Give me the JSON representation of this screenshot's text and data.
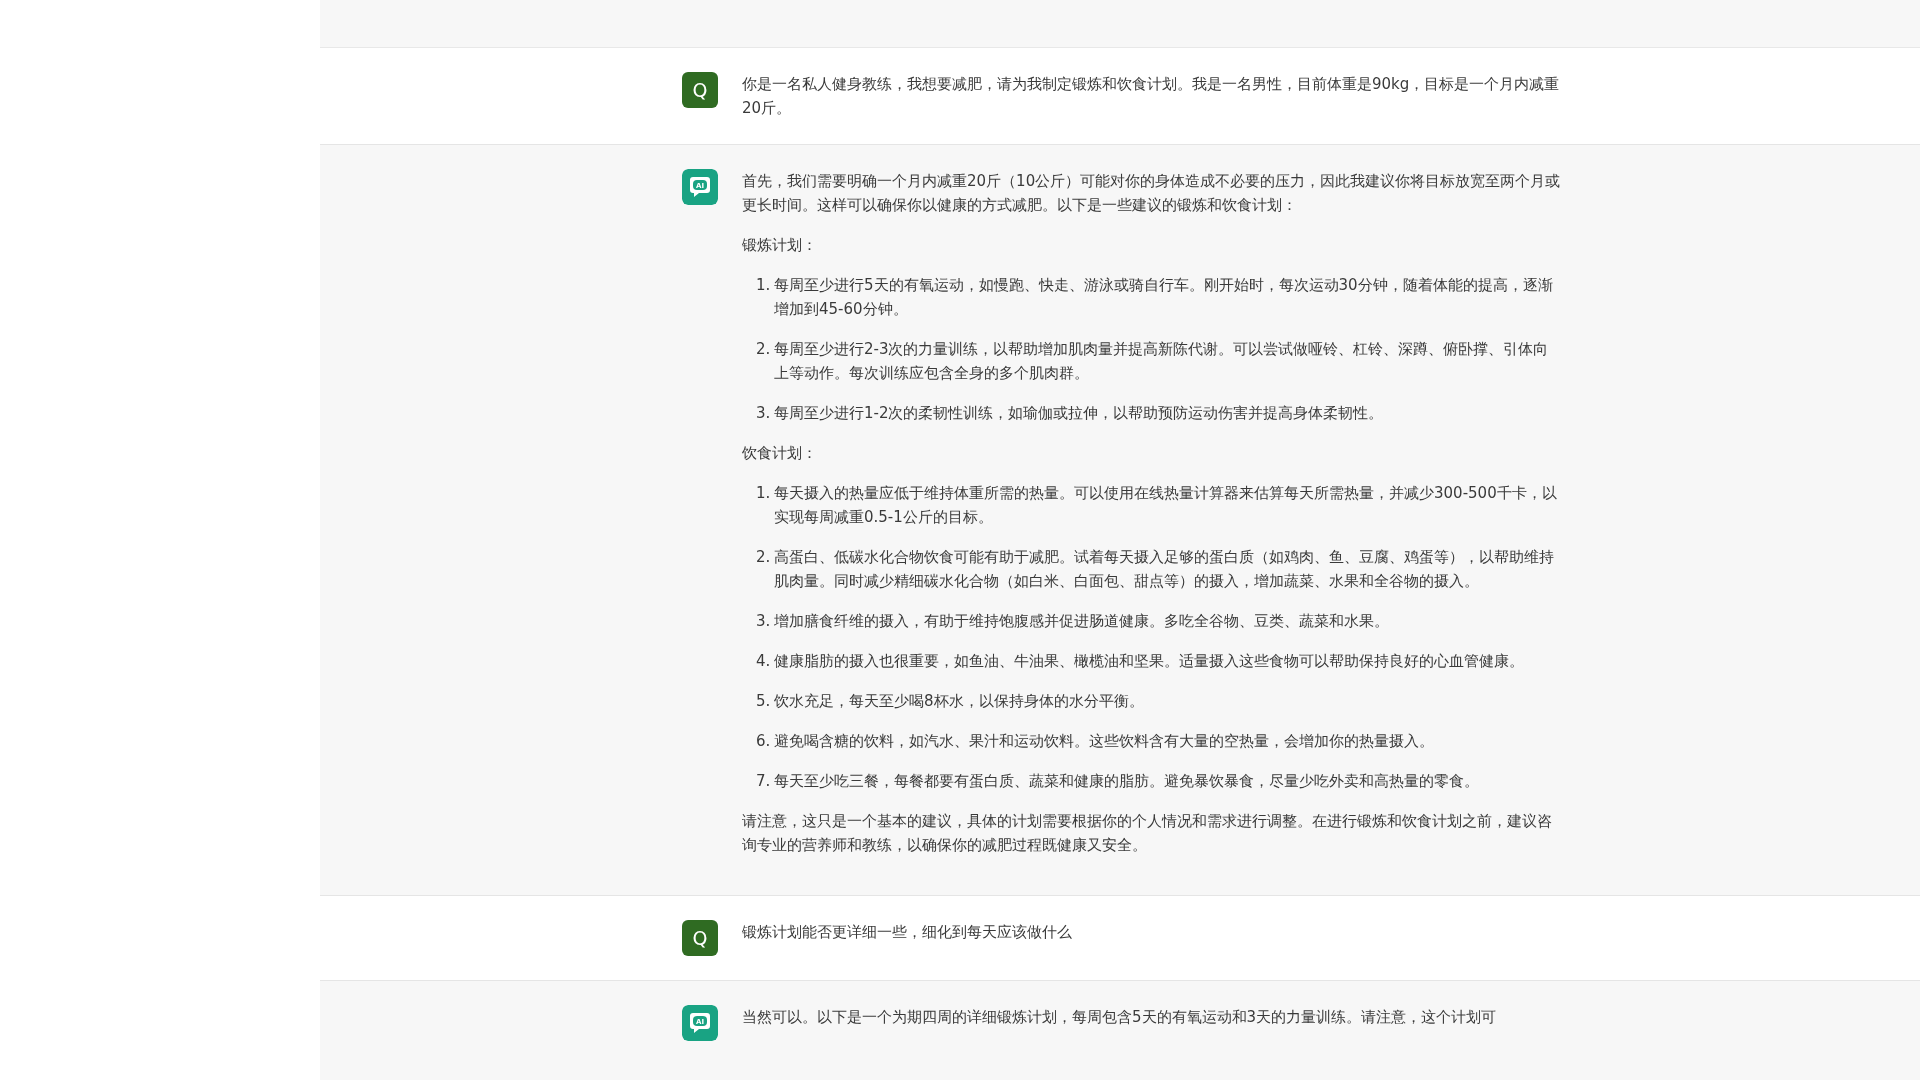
{
  "messages": [
    {
      "kind": "user",
      "avatar": "Q",
      "blocks": [
        {
          "kind": "paragraph",
          "text": "你是一名私人健身教练，我想要减肥，请为我制定锻炼和饮食计划。我是一名男性，目前体重是90kg，目标是一个月内减重20斤。"
        }
      ]
    },
    {
      "kind": "assistant",
      "avatar": "AI",
      "blocks": [
        {
          "kind": "paragraph",
          "text": "首先，我们需要明确一个月内减重20斤（10公斤）可能对你的身体造成不必要的压力，因此我建议你将目标放宽至两个月或更长时间。这样可以确保你以健康的方式减肥。以下是一些建议的锻炼和饮食计划："
        },
        {
          "kind": "paragraph",
          "text": "锻炼计划："
        },
        {
          "kind": "list",
          "items": [
            {
              "number": "1.",
              "text": "每周至少进行5天的有氧运动，如慢跑、快走、游泳或骑自行车。刚开始时，每次运动30分钟，随着体能的提高，逐渐增加到45-60分钟。"
            },
            {
              "number": "2.",
              "text": "每周至少进行2-3次的力量训练，以帮助增加肌肉量并提高新陈代谢。可以尝试做哑铃、杠铃、深蹲、俯卧撑、引体向上等动作。每次训练应包含全身的多个肌肉群。"
            },
            {
              "number": "3.",
              "text": "每周至少进行1-2次的柔韧性训练，如瑜伽或拉伸，以帮助预防运动伤害并提高身体柔韧性。"
            }
          ]
        },
        {
          "kind": "paragraph",
          "text": "饮食计划："
        },
        {
          "kind": "list",
          "items": [
            {
              "number": "1.",
              "text": "每天摄入的热量应低于维持体重所需的热量。可以使用在线热量计算器来估算每天所需热量，并减少300-500千卡，以实现每周减重0.5-1公斤的目标。"
            },
            {
              "number": "2.",
              "text": "高蛋白、低碳水化合物饮食可能有助于减肥。试着每天摄入足够的蛋白质（如鸡肉、鱼、豆腐、鸡蛋等），以帮助维持肌肉量。同时减少精细碳水化合物（如白米、白面包、甜点等）的摄入，增加蔬菜、水果和全谷物的摄入。"
            },
            {
              "number": "3.",
              "text": "增加膳食纤维的摄入，有助于维持饱腹感并促进肠道健康。多吃全谷物、豆类、蔬菜和水果。"
            },
            {
              "number": "4.",
              "text": "健康脂肪的摄入也很重要，如鱼油、牛油果、橄榄油和坚果。适量摄入这些食物可以帮助保持良好的心血管健康。"
            },
            {
              "number": "5.",
              "text": "饮水充足，每天至少喝8杯水，以保持身体的水分平衡。"
            },
            {
              "number": "6.",
              "text": "避免喝含糖的饮料，如汽水、果汁和运动饮料。这些饮料含有大量的空热量，会增加你的热量摄入。"
            },
            {
              "number": "7.",
              "text": "每天至少吃三餐，每餐都要有蛋白质、蔬菜和健康的脂肪。避免暴饮暴食，尽量少吃外卖和高热量的零食。"
            }
          ]
        },
        {
          "kind": "paragraph",
          "text": "请注意，这只是一个基本的建议，具体的计划需要根据你的个人情况和需求进行调整。在进行锻炼和饮食计划之前，建议咨询专业的营养师和教练，以确保你的减肥过程既健康又安全。"
        }
      ]
    },
    {
      "kind": "user",
      "avatar": "Q",
      "blocks": [
        {
          "kind": "paragraph",
          "text": "锻炼计划能否更详细一些，细化到每天应该做什么"
        }
      ]
    },
    {
      "kind": "assistant",
      "avatar": "AI",
      "blocks": [
        {
          "kind": "paragraph",
          "text": "当然可以。以下是一个为期四周的详细锻炼计划，每周包含5天的有氧运动和3天的力量训练。请注意，这个计划可"
        }
      ]
    }
  ]
}
